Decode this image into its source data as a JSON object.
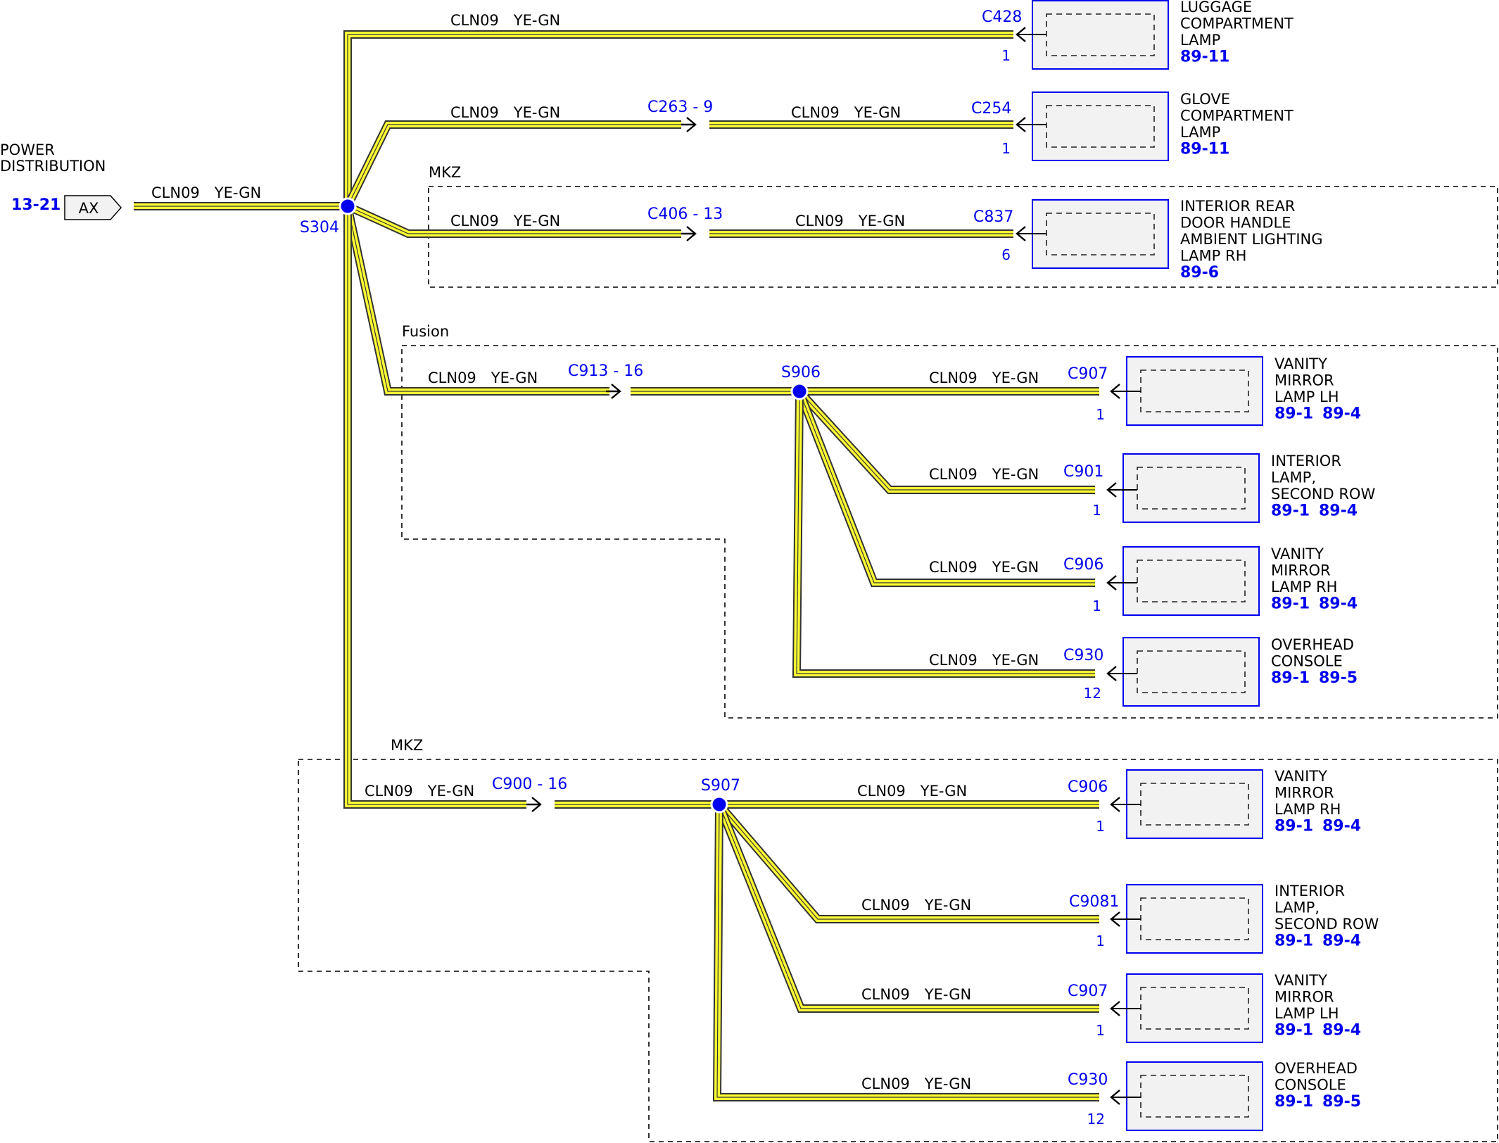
{
  "source": {
    "title_line1": "POWER",
    "title_line2": "DISTRIBUTION",
    "ref": "13-21",
    "connector": "AX"
  },
  "wire_label": {
    "circuit": "CLN09",
    "color": "YE-GN"
  },
  "splices": {
    "s304": "S304",
    "s906": "S906",
    "s907": "S907"
  },
  "inline_connectors": {
    "c263": "C263 - 9",
    "c406": "C406 - 13",
    "c913": "C913 - 16",
    "c900": "C900 - 16"
  },
  "option_groups": {
    "mkz_top": "MKZ",
    "fusion": "Fusion",
    "mkz_bottom": "MKZ"
  },
  "components": [
    {
      "connector": "C428",
      "pin": "1",
      "lines": [
        "LUGGAGE",
        "COMPARTMENT",
        "LAMP"
      ],
      "refs": [
        "89-11"
      ]
    },
    {
      "connector": "C254",
      "pin": "1",
      "lines": [
        "GLOVE",
        "COMPARTMENT",
        "LAMP"
      ],
      "refs": [
        "89-11"
      ]
    },
    {
      "connector": "C837",
      "pin": "6",
      "lines": [
        "INTERIOR REAR",
        "DOOR HANDLE",
        "AMBIENT LIGHTING",
        "LAMP RH"
      ],
      "refs": [
        "89-6"
      ]
    },
    {
      "connector": "C907",
      "pin": "1",
      "lines": [
        "VANITY",
        "MIRROR",
        "LAMP LH"
      ],
      "refs": [
        "89-1",
        "89-4"
      ]
    },
    {
      "connector": "C901",
      "pin": "1",
      "lines": [
        "INTERIOR",
        "LAMP,",
        "SECOND ROW"
      ],
      "refs": [
        "89-1",
        "89-4"
      ]
    },
    {
      "connector": "C906",
      "pin": "1",
      "lines": [
        "VANITY",
        "MIRROR",
        "LAMP RH"
      ],
      "refs": [
        "89-1",
        "89-4"
      ]
    },
    {
      "connector": "C930",
      "pin": "12",
      "lines": [
        "OVERHEAD",
        "CONSOLE"
      ],
      "refs": [
        "89-1",
        "89-5"
      ]
    },
    {
      "connector": "C906",
      "pin": "1",
      "lines": [
        "VANITY",
        "MIRROR",
        "LAMP RH"
      ],
      "refs": [
        "89-1",
        "89-4"
      ]
    },
    {
      "connector": "C9081",
      "pin": "1",
      "lines": [
        "INTERIOR",
        "LAMP,",
        "SECOND ROW"
      ],
      "refs": [
        "89-1",
        "89-4"
      ]
    },
    {
      "connector": "C907",
      "pin": "1",
      "lines": [
        "VANITY",
        "MIRROR",
        "LAMP LH"
      ],
      "refs": [
        "89-1",
        "89-4"
      ]
    },
    {
      "connector": "C930",
      "pin": "12",
      "lines": [
        "OVERHEAD",
        "CONSOLE"
      ],
      "refs": [
        "89-1",
        "89-5"
      ]
    }
  ]
}
